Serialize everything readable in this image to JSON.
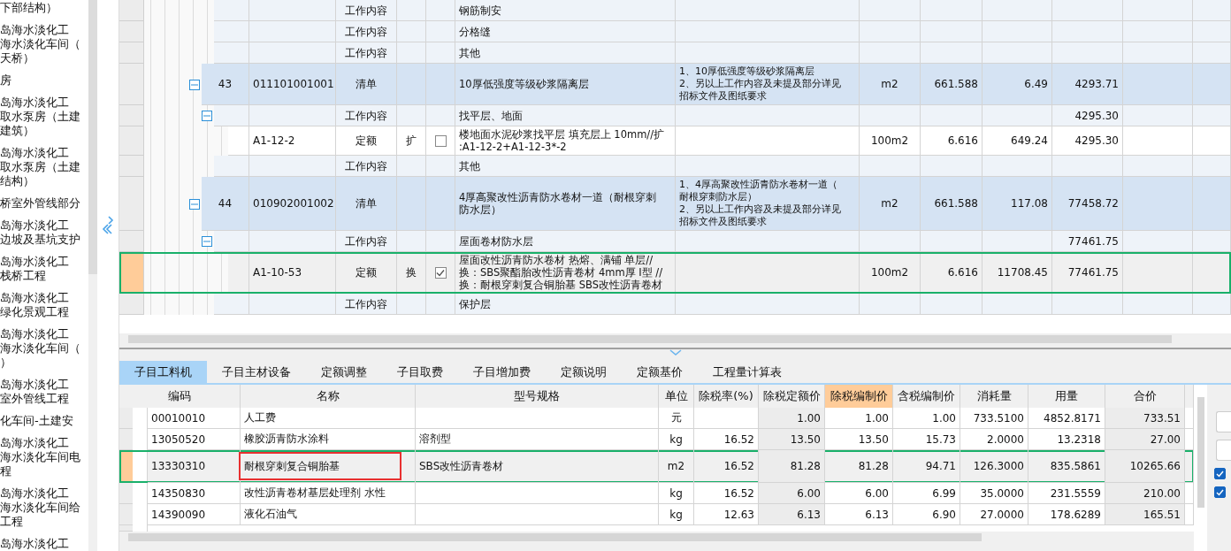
{
  "sidebar": {
    "items": [
      {
        "lines": [
          "下部结构）"
        ]
      },
      {
        "lines": [
          "岛海水淡化工",
          "海水淡化车间（",
          "天桥）"
        ]
      },
      {
        "lines": [
          "房"
        ]
      },
      {
        "lines": [
          "岛海水淡化工",
          "取水泵房（土建",
          "建筑）"
        ]
      },
      {
        "lines": [
          "岛海水淡化工",
          "取水泵房（土建",
          "结构）"
        ]
      },
      {
        "lines": [
          "桥室外管线部分"
        ]
      },
      {
        "lines": [
          "岛海水淡化工",
          "边坡及基坑支护"
        ]
      },
      {
        "lines": [
          "岛海水淡化工",
          "栈桥工程"
        ]
      },
      {
        "lines": [
          "岛海水淡化工",
          "绿化景观工程"
        ]
      },
      {
        "lines": [
          "岛海水淡化工",
          "海水淡化车间（",
          "）"
        ]
      },
      {
        "lines": [
          "岛海水淡化工",
          "室外管线工程"
        ]
      },
      {
        "lines": [
          "化车间-土建安"
        ]
      },
      {
        "lines": [
          "岛海水淡化工",
          "海水淡化车间电",
          "程"
        ]
      },
      {
        "lines": [
          "岛海水淡化工",
          "海水淡化车间给",
          "工程"
        ]
      },
      {
        "lines": [
          "岛海水淡化工"
        ]
      }
    ]
  },
  "quota_table": {
    "rows": [
      {
        "kind": "content",
        "type": "工作内容",
        "name": [
          "钢筋制安"
        ],
        "selected": false
      },
      {
        "kind": "content",
        "type": "工作内容",
        "name": [
          "分格缝"
        ],
        "selected": false
      },
      {
        "kind": "content",
        "type": "工作内容",
        "name": [
          "其他"
        ],
        "selected": false
      },
      {
        "kind": "list",
        "no": "43",
        "code": "011101001001",
        "type": "清单",
        "name": [
          "10厚低强度等级砂浆隔离层"
        ],
        "feature": [
          "1、10厚低强度等级砂浆隔离层",
          "2、另以上工作内容及未提及部分详见",
          "招标文件及图纸要求"
        ],
        "unit": "m2",
        "quantity": "661.588",
        "price": "6.49",
        "total": "4293.71",
        "selected": false,
        "expanded": true,
        "children": [
          {
            "kind": "content",
            "type": "工作内容",
            "name": [
              "找平层、地面"
            ],
            "total": "4295.30",
            "selected": false,
            "expanded": true,
            "children": [
              {
                "kind": "quota",
                "code": "A1-12-2",
                "type": "定额",
                "flag": "扩",
                "checked": false,
                "name": [
                  "楼地面水泥砂浆找平层 填充层上 10mm//扩",
                  ":A1-12-2+A1-12-3*-2"
                ],
                "unit": "100m2",
                "quantity": "6.616",
                "price": "649.24",
                "total": "4295.30",
                "selected": false
              }
            ]
          },
          {
            "kind": "content",
            "type": "工作内容",
            "name": [
              "其他"
            ],
            "selected": false
          }
        ]
      },
      {
        "kind": "list",
        "no": "44",
        "code": "010902001002",
        "type": "清单",
        "name": [
          "4厚高聚改性沥青防水卷材一道（耐根穿刺",
          "防水层）"
        ],
        "feature": [
          "1、4厚高聚改性沥青防水卷材一道（",
          "耐根穿刺防水层）",
          "2、另以上工作内容及未提及部分详见",
          "招标文件及图纸要求"
        ],
        "unit": "m2",
        "quantity": "661.588",
        "price": "117.08",
        "total": "77458.72",
        "selected": false,
        "expanded": true,
        "children": [
          {
            "kind": "content",
            "type": "工作内容",
            "name": [
              "屋面卷材防水层"
            ],
            "total": "77461.75",
            "selected": false,
            "expanded": true,
            "children": [
              {
                "kind": "quota",
                "code": "A1-10-53",
                "type": "定额",
                "flag": "换",
                "checked": true,
                "name": [
                  "屋面改性沥青防水卷材 热熔、满铺 单层//",
                  "换：SBS聚酯胎改性沥青卷材 4mm厚 I型 //",
                  "换：耐根穿刺复合铜胎基 SBS改性沥青卷材"
                ],
                "unit": "100m2",
                "quantity": "6.616",
                "price": "11708.45",
                "total": "77461.75",
                "selected": true
              }
            ]
          },
          {
            "kind": "content",
            "type": "工作内容",
            "name": [
              "保护层"
            ],
            "selected": false
          }
        ]
      }
    ]
  },
  "tabs": [
    {
      "label": "子目工料机",
      "selected": true
    },
    {
      "label": "子目主材设备",
      "selected": false
    },
    {
      "label": "定额调整",
      "selected": false
    },
    {
      "label": "子目取费",
      "selected": false
    },
    {
      "label": "子目增加费",
      "selected": false
    },
    {
      "label": "定额说明",
      "selected": false
    },
    {
      "label": "定额基价",
      "selected": false
    },
    {
      "label": "工程量计算表",
      "selected": false
    }
  ],
  "material_table": {
    "columns": [
      {
        "label": "编码",
        "highlighted": false
      },
      {
        "label": "名称",
        "highlighted": false
      },
      {
        "label": "型号规格",
        "highlighted": false
      },
      {
        "label": "单位",
        "highlighted": false
      },
      {
        "label": "除税率(%)",
        "highlighted": false
      },
      {
        "label": "除税定额价",
        "highlighted": false
      },
      {
        "label": "除税编制价",
        "highlighted": true
      },
      {
        "label": "含税编制价",
        "highlighted": false
      },
      {
        "label": "消耗量",
        "highlighted": false
      },
      {
        "label": "用量",
        "highlighted": false
      },
      {
        "label": "合价",
        "highlighted": false
      }
    ],
    "rows": [
      {
        "code": "00010010",
        "name": "人工费",
        "unit": "元",
        "base_price": "1.00",
        "price": "1.00",
        "tax_price": "1.00",
        "consumption": "733.5100",
        "amount": "4852.8171",
        "total": "733.51",
        "selected": false,
        "annotated": false
      },
      {
        "code": "13050520",
        "name": "橡胶沥青防水涂料",
        "spec": "溶剂型",
        "unit": "kg",
        "rate": "16.52",
        "base_price": "13.50",
        "price": "13.50",
        "tax_price": "15.73",
        "consumption": "2.0000",
        "amount": "13.2318",
        "total": "27.00",
        "selected": false,
        "annotated": false
      },
      {
        "code": "13330310",
        "name": "耐根穿刺复合铜胎基",
        "spec": "SBS改性沥青卷材",
        "unit": "m2",
        "rate": "16.52",
        "base_price": "81.28",
        "price": "81.28",
        "tax_price": "94.71",
        "consumption": "126.3000",
        "amount": "835.5861",
        "total": "10265.66",
        "selected": true,
        "annotated": true
      },
      {
        "code": "14350830",
        "name": "改性沥青卷材基层处理剂 水性",
        "unit": "kg",
        "rate": "16.52",
        "base_price": "6.00",
        "price": "6.00",
        "tax_price": "6.99",
        "consumption": "35.0000",
        "amount": "231.5559",
        "total": "210.00",
        "selected": false,
        "annotated": false
      },
      {
        "code": "14390090",
        "name": "液化石油气",
        "unit": "kg",
        "rate": "12.63",
        "base_price": "6.13",
        "price": "6.13",
        "tax_price": "6.90",
        "consumption": "27.0000",
        "amount": "178.6289",
        "total": "165.51",
        "selected": false,
        "annotated": false
      }
    ]
  },
  "side_panel": {
    "checkboxes": [
      {
        "checked": true
      },
      {
        "checked": true
      }
    ]
  }
}
